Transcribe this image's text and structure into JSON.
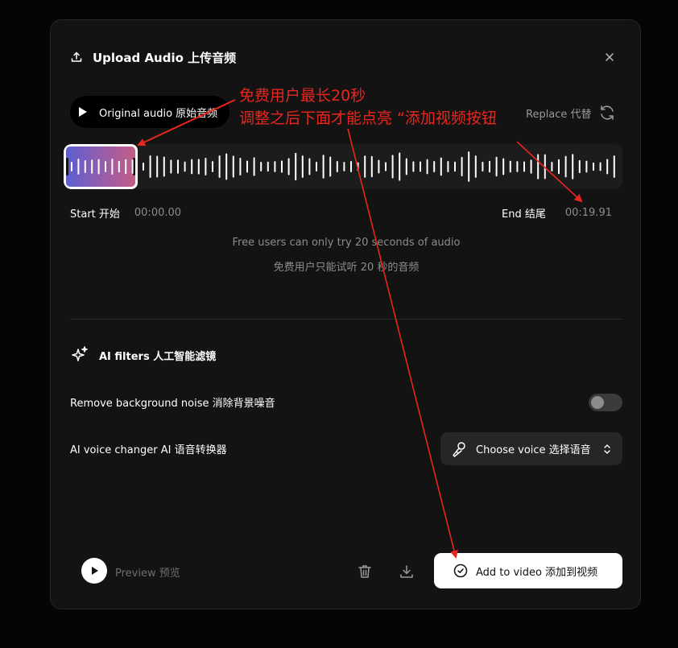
{
  "dialog": {
    "title": "Upload Audio  上传音频"
  },
  "audio": {
    "original_label": "Original audio  原始音频",
    "replace_label": "Replace  代替"
  },
  "trim": {
    "start_label": "Start  开始",
    "start_time": "00:00.00",
    "end_label": "End  结尾",
    "end_time": "00:19.91"
  },
  "notice": {
    "line_en": "Free users can only try 20 seconds of audio",
    "line_zh": "免费用户只能试听 20 秒的音频"
  },
  "ai_filters": {
    "title": "AI filters  人工智能滤镜",
    "noise_label": "Remove background noise  消除背景噪音",
    "noise_enabled": false,
    "voice_changer_label": "AI voice changer  AI 语音转换器",
    "voice_select_value": "Choose voice  选择语音"
  },
  "footer": {
    "preview_label": "Preview  预览",
    "add_button_label": "Add to video  添加到视频"
  },
  "annotation": {
    "line1": "免费用户最长20秒",
    "line2": "调整之后下面才能点亮 “添加视频按钮",
    "color": "#e8261d"
  },
  "colors": {
    "background": "#050505",
    "panel": "#131313",
    "waveform_track": "#1c1c1c",
    "selection_start": "#5a5fd1",
    "selection_end": "#c25e86"
  }
}
